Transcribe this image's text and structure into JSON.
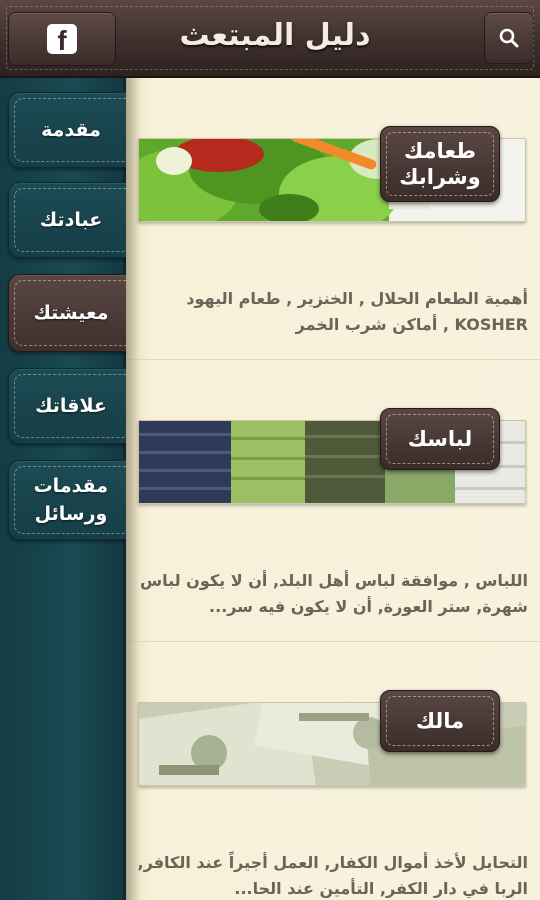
{
  "header": {
    "title": "دليل المبتعث",
    "facebook_icon": "facebook-icon",
    "search_icon": "search-icon"
  },
  "sidebar": {
    "items": [
      {
        "label": "مقدمة",
        "active": false
      },
      {
        "label": "عبادتك",
        "active": false
      },
      {
        "label": "معيشتك",
        "active": true
      },
      {
        "label": "علاقاتك",
        "active": false
      },
      {
        "label": "مقدمات ورسائل",
        "active": false
      }
    ]
  },
  "cards": [
    {
      "tag": "طعامك وشرابك",
      "image": "salad-photo",
      "description": "أهمية الطعام الحلال , الخنزير , طعام اليهود KOSHER , أماكن شرب الخمر"
    },
    {
      "tag": "لباسك",
      "image": "folded-clothes-photo",
      "description": "اللباس , موافقة لباس أهل البلد, أن لا يكون لباس شهرة, ستر العورة, أن لا يكون فيه سر..."
    },
    {
      "tag": "مالك",
      "image": "dollar-bills-photo",
      "description": "التحايل لأخذ أموال الكفار, العمل أجيراً عند الكافر, الربا في دار الكفر, التأمين عند الحا..."
    }
  ],
  "colors": {
    "header_brown": "#3e302d",
    "sidebar_teal": "#1a4a52",
    "content_cream": "#f7f2dd",
    "description_text": "#6b6458"
  }
}
